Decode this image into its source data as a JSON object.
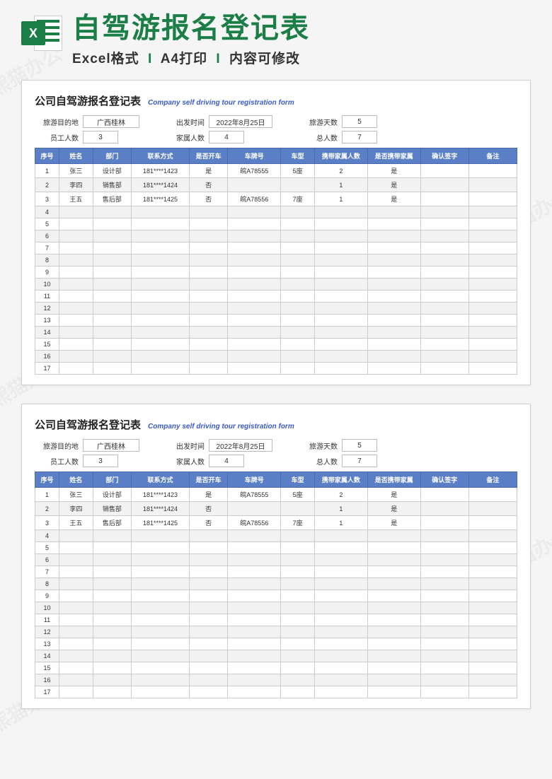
{
  "header": {
    "big_title": "自驾游报名登记表",
    "sub_parts": [
      "Excel格式",
      "A4打印",
      "内容可修改"
    ],
    "excel_letter": "X"
  },
  "sheet": {
    "title_cn": "公司自驾游报名登记表",
    "title_en": "Company self driving tour registration form",
    "info": {
      "dest_label": "旅游目的地",
      "dest_value": "广西桂林",
      "depart_label": "出发时间",
      "depart_value": "2022年8月25日",
      "days_label": "旅游天数",
      "days_value": "5",
      "emp_label": "员工人数",
      "emp_value": "3",
      "fam_label": "家属人数",
      "fam_value": "4",
      "total_label": "总人数",
      "total_value": "7"
    },
    "columns": [
      "序号",
      "姓名",
      "部门",
      "联系方式",
      "是否开车",
      "车牌号",
      "车型",
      "携带家属人数",
      "是否携带家属",
      "确认签字",
      "备注"
    ],
    "rows": [
      {
        "seq": "1",
        "name": "张三",
        "dept": "设计部",
        "phone": "181****1423",
        "drive": "是",
        "plate": "皖A78555",
        "type": "5座",
        "fam": "2",
        "hasfam": "是",
        "sign": "",
        "note": ""
      },
      {
        "seq": "2",
        "name": "李四",
        "dept": "销售部",
        "phone": "181****1424",
        "drive": "否",
        "plate": "",
        "type": "",
        "fam": "1",
        "hasfam": "是",
        "sign": "",
        "note": ""
      },
      {
        "seq": "3",
        "name": "王五",
        "dept": "售后部",
        "phone": "181****1425",
        "drive": "否",
        "plate": "皖A78556",
        "type": "7座",
        "fam": "1",
        "hasfam": "是",
        "sign": "",
        "note": ""
      },
      {
        "seq": "4"
      },
      {
        "seq": "5"
      },
      {
        "seq": "6"
      },
      {
        "seq": "7"
      },
      {
        "seq": "8"
      },
      {
        "seq": "9"
      },
      {
        "seq": "10"
      },
      {
        "seq": "11"
      },
      {
        "seq": "12"
      },
      {
        "seq": "13"
      },
      {
        "seq": "14"
      },
      {
        "seq": "15"
      },
      {
        "seq": "16"
      },
      {
        "seq": "17"
      }
    ]
  },
  "watermark_text": "熊猫办公"
}
